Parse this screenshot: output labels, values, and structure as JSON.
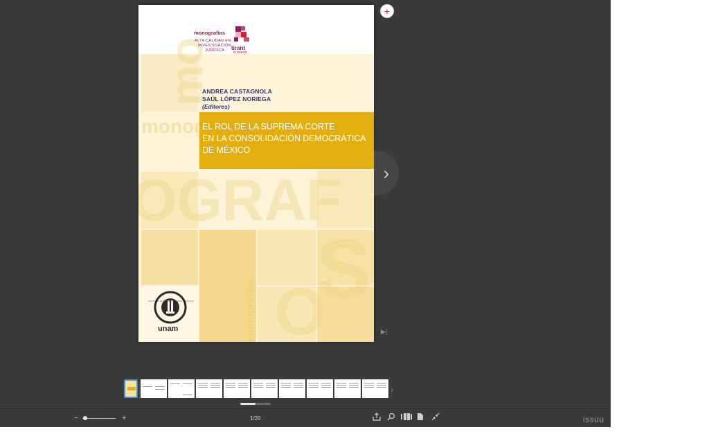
{
  "book": {
    "series": "monografías",
    "tagline": [
      "ALTA CALIDAD EN",
      "INVESTIGACIÓN",
      "JURÍDICA"
    ],
    "publisher": "tirant",
    "publisher_sub": "lo blanch",
    "editors": [
      "ANDREA CASTAGNOLA",
      "SAÚL LÓPEZ NORIEGA"
    ],
    "editors_note": "(Editores)",
    "title_lines": [
      "EL ROL DE LA SUPREMA CORTE",
      "EN LA CONSOLIDACIÓN DEMOCRÁTICA",
      "DE MÉXICO"
    ],
    "watermark_words": [
      "mo",
      "monog",
      "OGRAF",
      "S",
      "O"
    ],
    "side_series": "monografías",
    "institution_seal_text": "INSTITUTO DE INVESTIGACIONES JURÍDICAS",
    "institution": "unam"
  },
  "viewer": {
    "page_counter": "1/20",
    "brand": "issuu",
    "colors": {
      "background": "#3a3a3a",
      "title_band": "#e3ae0e",
      "accent_red": "#e01e2b",
      "editor_blue": "#2f3577"
    },
    "icons": {
      "zoom": "plus-circle-icon",
      "next": "chevron-right-icon",
      "end": "skip-end-icon",
      "share": "share-icon",
      "search": "search-icon",
      "grid": "thumbnails-icon",
      "single": "single-page-icon",
      "fullscreen": "fullscreen-exit-icon"
    }
  }
}
